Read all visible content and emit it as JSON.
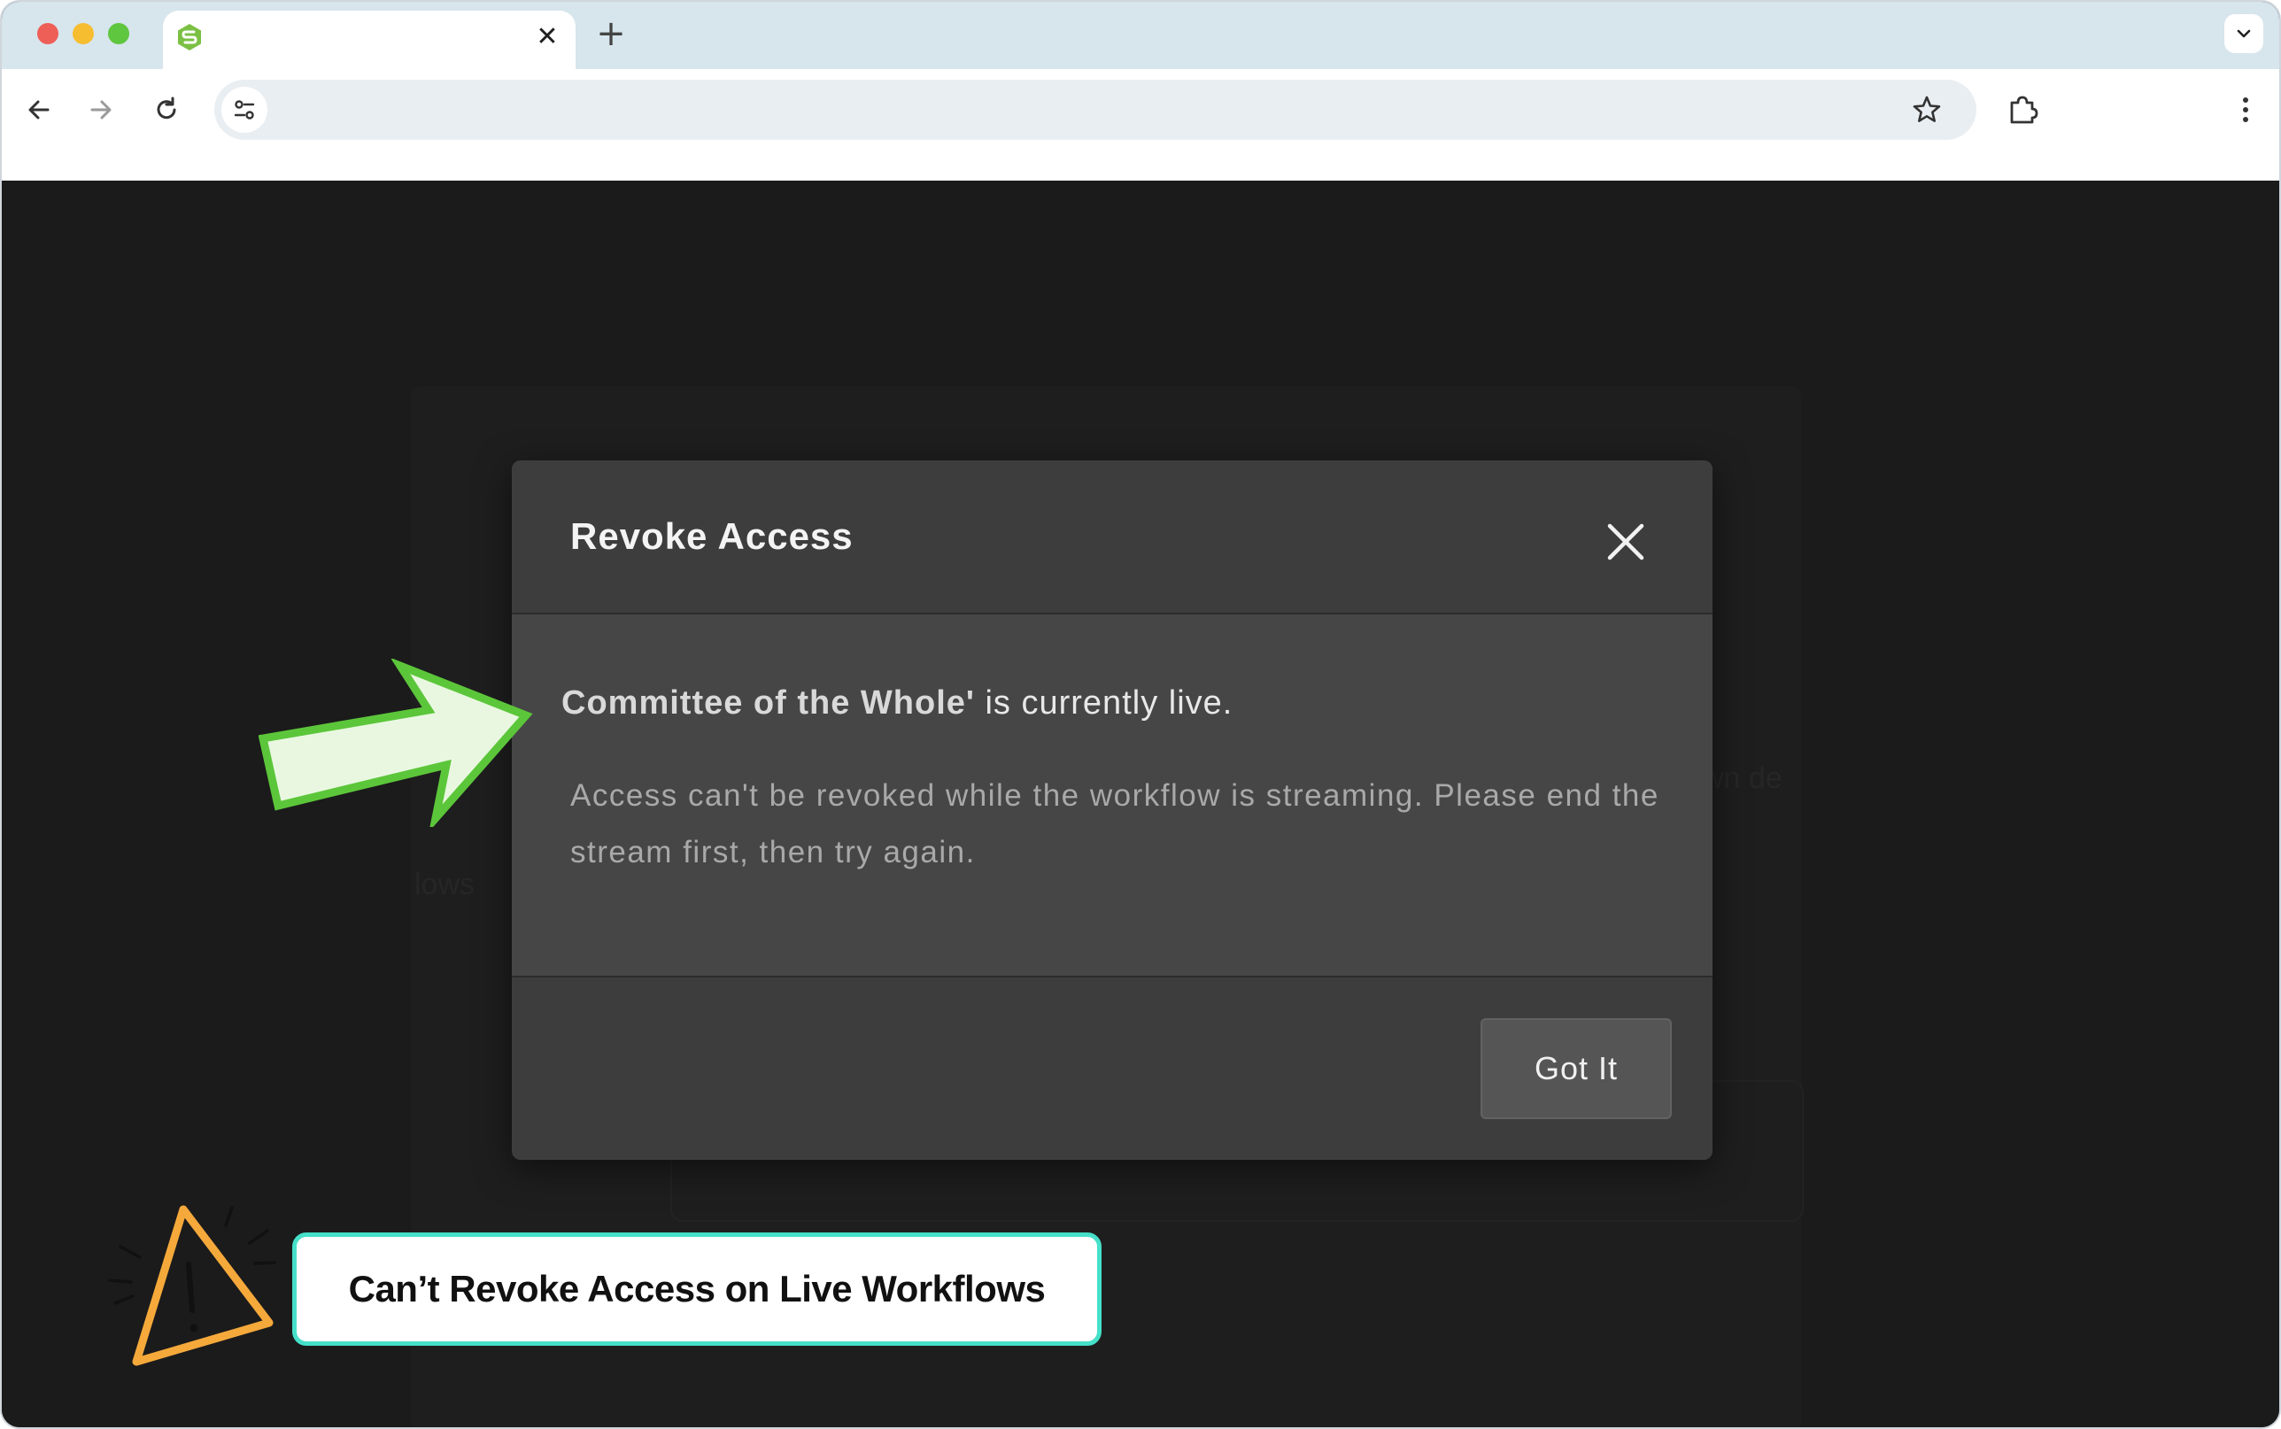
{
  "browser": {
    "tab": {
      "title": "",
      "favicon": "green-hexagon-logo-icon"
    },
    "omnibox": {
      "url": ""
    },
    "icons": {
      "back": "arrow-left-icon",
      "forward": "arrow-right-icon",
      "reload": "reload-icon",
      "site_info": "tune-icon",
      "bookmark": "star-icon",
      "extensions": "puzzle-icon",
      "menu": "kebab-menu-icon"
    }
  },
  "background": {
    "partial_text_left": "lows",
    "partial_text_right": "wn de"
  },
  "modal": {
    "title": "Revoke Access",
    "workflow_name": "Committee of the Whole'",
    "live_suffix": " is currently live.",
    "message": "Access can't be revoked while the workflow is streaming. Please end the stream first, then try again.",
    "confirm_label": "Got It"
  },
  "annotation": {
    "callout_text": "Can’t Revoke Access on Live Workflows",
    "arrow_color": "#5cc63a",
    "warning_color": "#f5a93b",
    "callout_border_color": "#46e0c9"
  },
  "colors": {
    "page_background": "#1b1b1b",
    "modal_body": "#464646",
    "modal_header_footer": "#3d3d3d",
    "tabstrip": "#d7e5ec"
  }
}
